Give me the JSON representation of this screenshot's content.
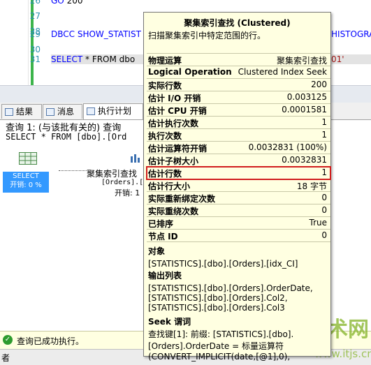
{
  "editor": {
    "lines": [
      {
        "num": "26",
        "code_kw": "GO",
        "code_rest": " 200"
      },
      {
        "num": "27",
        "code_kw": "",
        "code_rest": ""
      },
      {
        "num": "28",
        "code_kw": "",
        "code_rest": ""
      },
      {
        "num": "29",
        "code_kw": "DBCC SHOW_STATIST",
        "code_rest": "",
        "code_tail": "HISTOGRA"
      },
      {
        "num": "30",
        "code_kw": "",
        "code_rest": ""
      },
      {
        "num": "31",
        "code_kw": "SELECT",
        "code_rest": " * FROM dbo",
        "code_tail": "01'"
      }
    ]
  },
  "tabs": [
    {
      "label": "结果",
      "icon": "grid-icon"
    },
    {
      "label": "消息",
      "icon": "message-icon"
    },
    {
      "label": "执行计划",
      "icon": "plan-icon"
    }
  ],
  "results": {
    "query_header": "查询 1: (与该批有关的) 查询",
    "query_sql": "SELECT * FROM [dbo].[Ord",
    "select_node": {
      "label1": "SELECT",
      "label2": "开销: 0 %"
    },
    "seek_node": {
      "label": "聚集索引查找",
      "sub1": "[Orders].[",
      "sub2": "开销: 1"
    }
  },
  "tooltip": {
    "title": "聚集索引查找 (Clustered)",
    "description": "扫描聚集索引中特定范围的行。",
    "rows": [
      {
        "key": "物理运算",
        "value": "聚集索引查找",
        "highlight": false
      },
      {
        "key": "Logical Operation",
        "value": "Clustered Index Seek",
        "highlight": false
      },
      {
        "key": "实际行数",
        "value": "200",
        "highlight": false
      },
      {
        "key": "估计 I/O 开销",
        "value": "0.003125",
        "highlight": false
      },
      {
        "key": "估计 CPU 开销",
        "value": "0.0001581",
        "highlight": false
      },
      {
        "key": "估计执行次数",
        "value": "1",
        "highlight": false
      },
      {
        "key": "执行次数",
        "value": "1",
        "highlight": false
      },
      {
        "key": "估计运算符开销",
        "value": "0.0032831 (100%)",
        "highlight": false
      },
      {
        "key": "估计子树大小",
        "value": "0.0032831",
        "highlight": false
      },
      {
        "key": "估计行数",
        "value": "1",
        "highlight": true
      },
      {
        "key": "估计行大小",
        "value": "18 字节",
        "highlight": false
      },
      {
        "key": "实际重新绑定次数",
        "value": "0",
        "highlight": false
      },
      {
        "key": "实际重绕次数",
        "value": "0",
        "highlight": false
      },
      {
        "key": "已排序",
        "value": "True",
        "highlight": false
      },
      {
        "key": "节点 ID",
        "value": "0",
        "highlight": false
      }
    ],
    "object_heading": "对象",
    "object_value": "[STATISTICS].[dbo].[Orders].[idx_CI]",
    "output_heading": "输出列表",
    "output_lines": [
      "[STATISTICS].[dbo].[Orders].OrderDate,",
      "[STATISTICS].[dbo].[Orders].Col2,",
      "[STATISTICS].[dbo].[Orders].Col3"
    ],
    "seek_heading": "Seek 谓词",
    "seek_lines": [
      "查找键[1]: 前缀: [STATISTICS].[dbo].",
      "[Orders].OrderDate = 标量运算符",
      "(CONVERT_IMPLICIT(date,[@1],0),"
    ]
  },
  "status": {
    "text": "查询已成功执行。",
    "icon": "check-circle-icon"
  },
  "bottom": {
    "text": "者"
  },
  "watermark": {
    "brand": "技术网",
    "url": "www.itjs.cn"
  }
}
